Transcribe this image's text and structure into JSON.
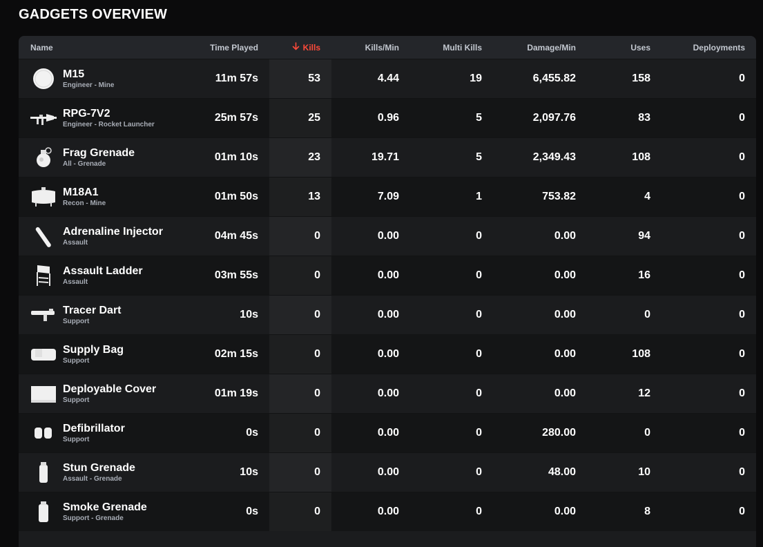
{
  "page": {
    "title": "GADGETS OVERVIEW"
  },
  "colors": {
    "accent_sort": "#ff4a3a",
    "row_odd": "#1b1c1e",
    "row_even": "#141516",
    "header_bg": "#24262a"
  },
  "table": {
    "columns": {
      "name": "Name",
      "time_played": "Time Played",
      "kills": "Kills",
      "kills_per_min": "Kills/Min",
      "multi_kills": "Multi Kills",
      "damage_per_min": "Damage/Min",
      "uses": "Uses",
      "deployments": "Deployments"
    },
    "sort": {
      "column": "kills",
      "direction": "descending",
      "icon": "arrow-down-icon"
    },
    "rows": [
      {
        "name": "M15",
        "sub": "Engineer - Mine",
        "icon": "mine-disc-icon",
        "time": "11m 57s",
        "kills": "53",
        "kpm": "4.44",
        "multi": "19",
        "dmg": "6,455.82",
        "uses": "158",
        "deploy": "0"
      },
      {
        "name": "RPG-7V2",
        "sub": "Engineer - Rocket Launcher",
        "icon": "rocket-launcher-icon",
        "time": "25m 57s",
        "kills": "25",
        "kpm": "0.96",
        "multi": "5",
        "dmg": "2,097.76",
        "uses": "83",
        "deploy": "0"
      },
      {
        "name": "Frag Grenade",
        "sub": "All - Grenade",
        "icon": "frag-grenade-icon",
        "time": "01m 10s",
        "kills": "23",
        "kpm": "19.71",
        "multi": "5",
        "dmg": "2,349.43",
        "uses": "108",
        "deploy": "0"
      },
      {
        "name": "M18A1",
        "sub": "Recon - Mine",
        "icon": "claymore-mine-icon",
        "time": "01m 50s",
        "kills": "13",
        "kpm": "7.09",
        "multi": "1",
        "dmg": "753.82",
        "uses": "4",
        "deploy": "0"
      },
      {
        "name": "Adrenaline Injector",
        "sub": "Assault",
        "icon": "injector-icon",
        "time": "04m 45s",
        "kills": "0",
        "kpm": "0.00",
        "multi": "0",
        "dmg": "0.00",
        "uses": "94",
        "deploy": "0"
      },
      {
        "name": "Assault Ladder",
        "sub": "Assault",
        "icon": "ladder-icon",
        "time": "03m 55s",
        "kills": "0",
        "kpm": "0.00",
        "multi": "0",
        "dmg": "0.00",
        "uses": "16",
        "deploy": "0"
      },
      {
        "name": "Tracer Dart",
        "sub": "Support",
        "icon": "dart-gun-icon",
        "time": "10s",
        "kills": "0",
        "kpm": "0.00",
        "multi": "0",
        "dmg": "0.00",
        "uses": "0",
        "deploy": "0"
      },
      {
        "name": "Supply Bag",
        "sub": "Support",
        "icon": "supply-bag-icon",
        "time": "02m 15s",
        "kills": "0",
        "kpm": "0.00",
        "multi": "0",
        "dmg": "0.00",
        "uses": "108",
        "deploy": "0"
      },
      {
        "name": "Deployable Cover",
        "sub": "Support",
        "icon": "cover-icon",
        "time": "01m 19s",
        "kills": "0",
        "kpm": "0.00",
        "multi": "0",
        "dmg": "0.00",
        "uses": "12",
        "deploy": "0"
      },
      {
        "name": "Defibrillator",
        "sub": "Support",
        "icon": "defibrillator-icon",
        "time": "0s",
        "kills": "0",
        "kpm": "0.00",
        "multi": "0",
        "dmg": "280.00",
        "uses": "0",
        "deploy": "0"
      },
      {
        "name": "Stun Grenade",
        "sub": "Assault - Grenade",
        "icon": "stun-grenade-icon",
        "time": "10s",
        "kills": "0",
        "kpm": "0.00",
        "multi": "0",
        "dmg": "48.00",
        "uses": "10",
        "deploy": "0"
      },
      {
        "name": "Smoke Grenade",
        "sub": "Support - Grenade",
        "icon": "smoke-grenade-icon",
        "time": "0s",
        "kills": "0",
        "kpm": "0.00",
        "multi": "0",
        "dmg": "0.00",
        "uses": "8",
        "deploy": "0"
      }
    ]
  }
}
